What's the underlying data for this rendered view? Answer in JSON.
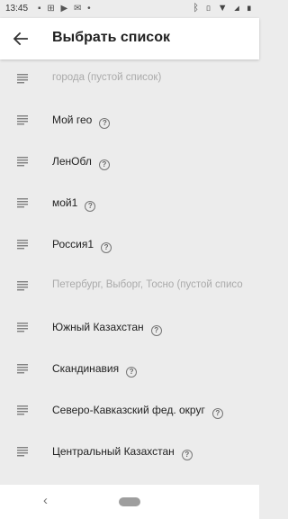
{
  "status": {
    "time": "13:45",
    "left_icons": [
      "image-icon",
      "grid-icon",
      "youtube-icon",
      "mail-icon",
      "dot-icon"
    ],
    "right_icons": [
      "bluetooth-icon",
      "vibrate-icon",
      "wifi-icon",
      "signal-icon",
      "battery-icon"
    ]
  },
  "header": {
    "title": "Выбрать список"
  },
  "lists": [
    {
      "label": "города (пустой список)",
      "empty": true,
      "help": false
    },
    {
      "label": "Мой гео",
      "empty": false,
      "help": true
    },
    {
      "label": "ЛенОбл",
      "empty": false,
      "help": true
    },
    {
      "label": "мой1",
      "empty": false,
      "help": true
    },
    {
      "label": "Россия1",
      "empty": false,
      "help": true
    },
    {
      "label": "Петербург, Выборг, Тосно (пустой список)",
      "empty": true,
      "help": false
    },
    {
      "label": "Южный Казахстан",
      "empty": false,
      "help": true
    },
    {
      "label": "Скандинавия",
      "empty": false,
      "help": true
    },
    {
      "label": "Северо-Кавказский фед. округ",
      "empty": false,
      "help": true
    },
    {
      "label": "Центральный Казахстан",
      "empty": false,
      "help": true
    },
    {
      "label": "",
      "empty": false,
      "help": false
    }
  ],
  "nav": {
    "back_glyph": "‹"
  },
  "help_glyph": "?",
  "colors": {
    "background": "#ececec",
    "appbar": "#ffffff",
    "text": "#222222",
    "muted": "#aaaaaa"
  }
}
